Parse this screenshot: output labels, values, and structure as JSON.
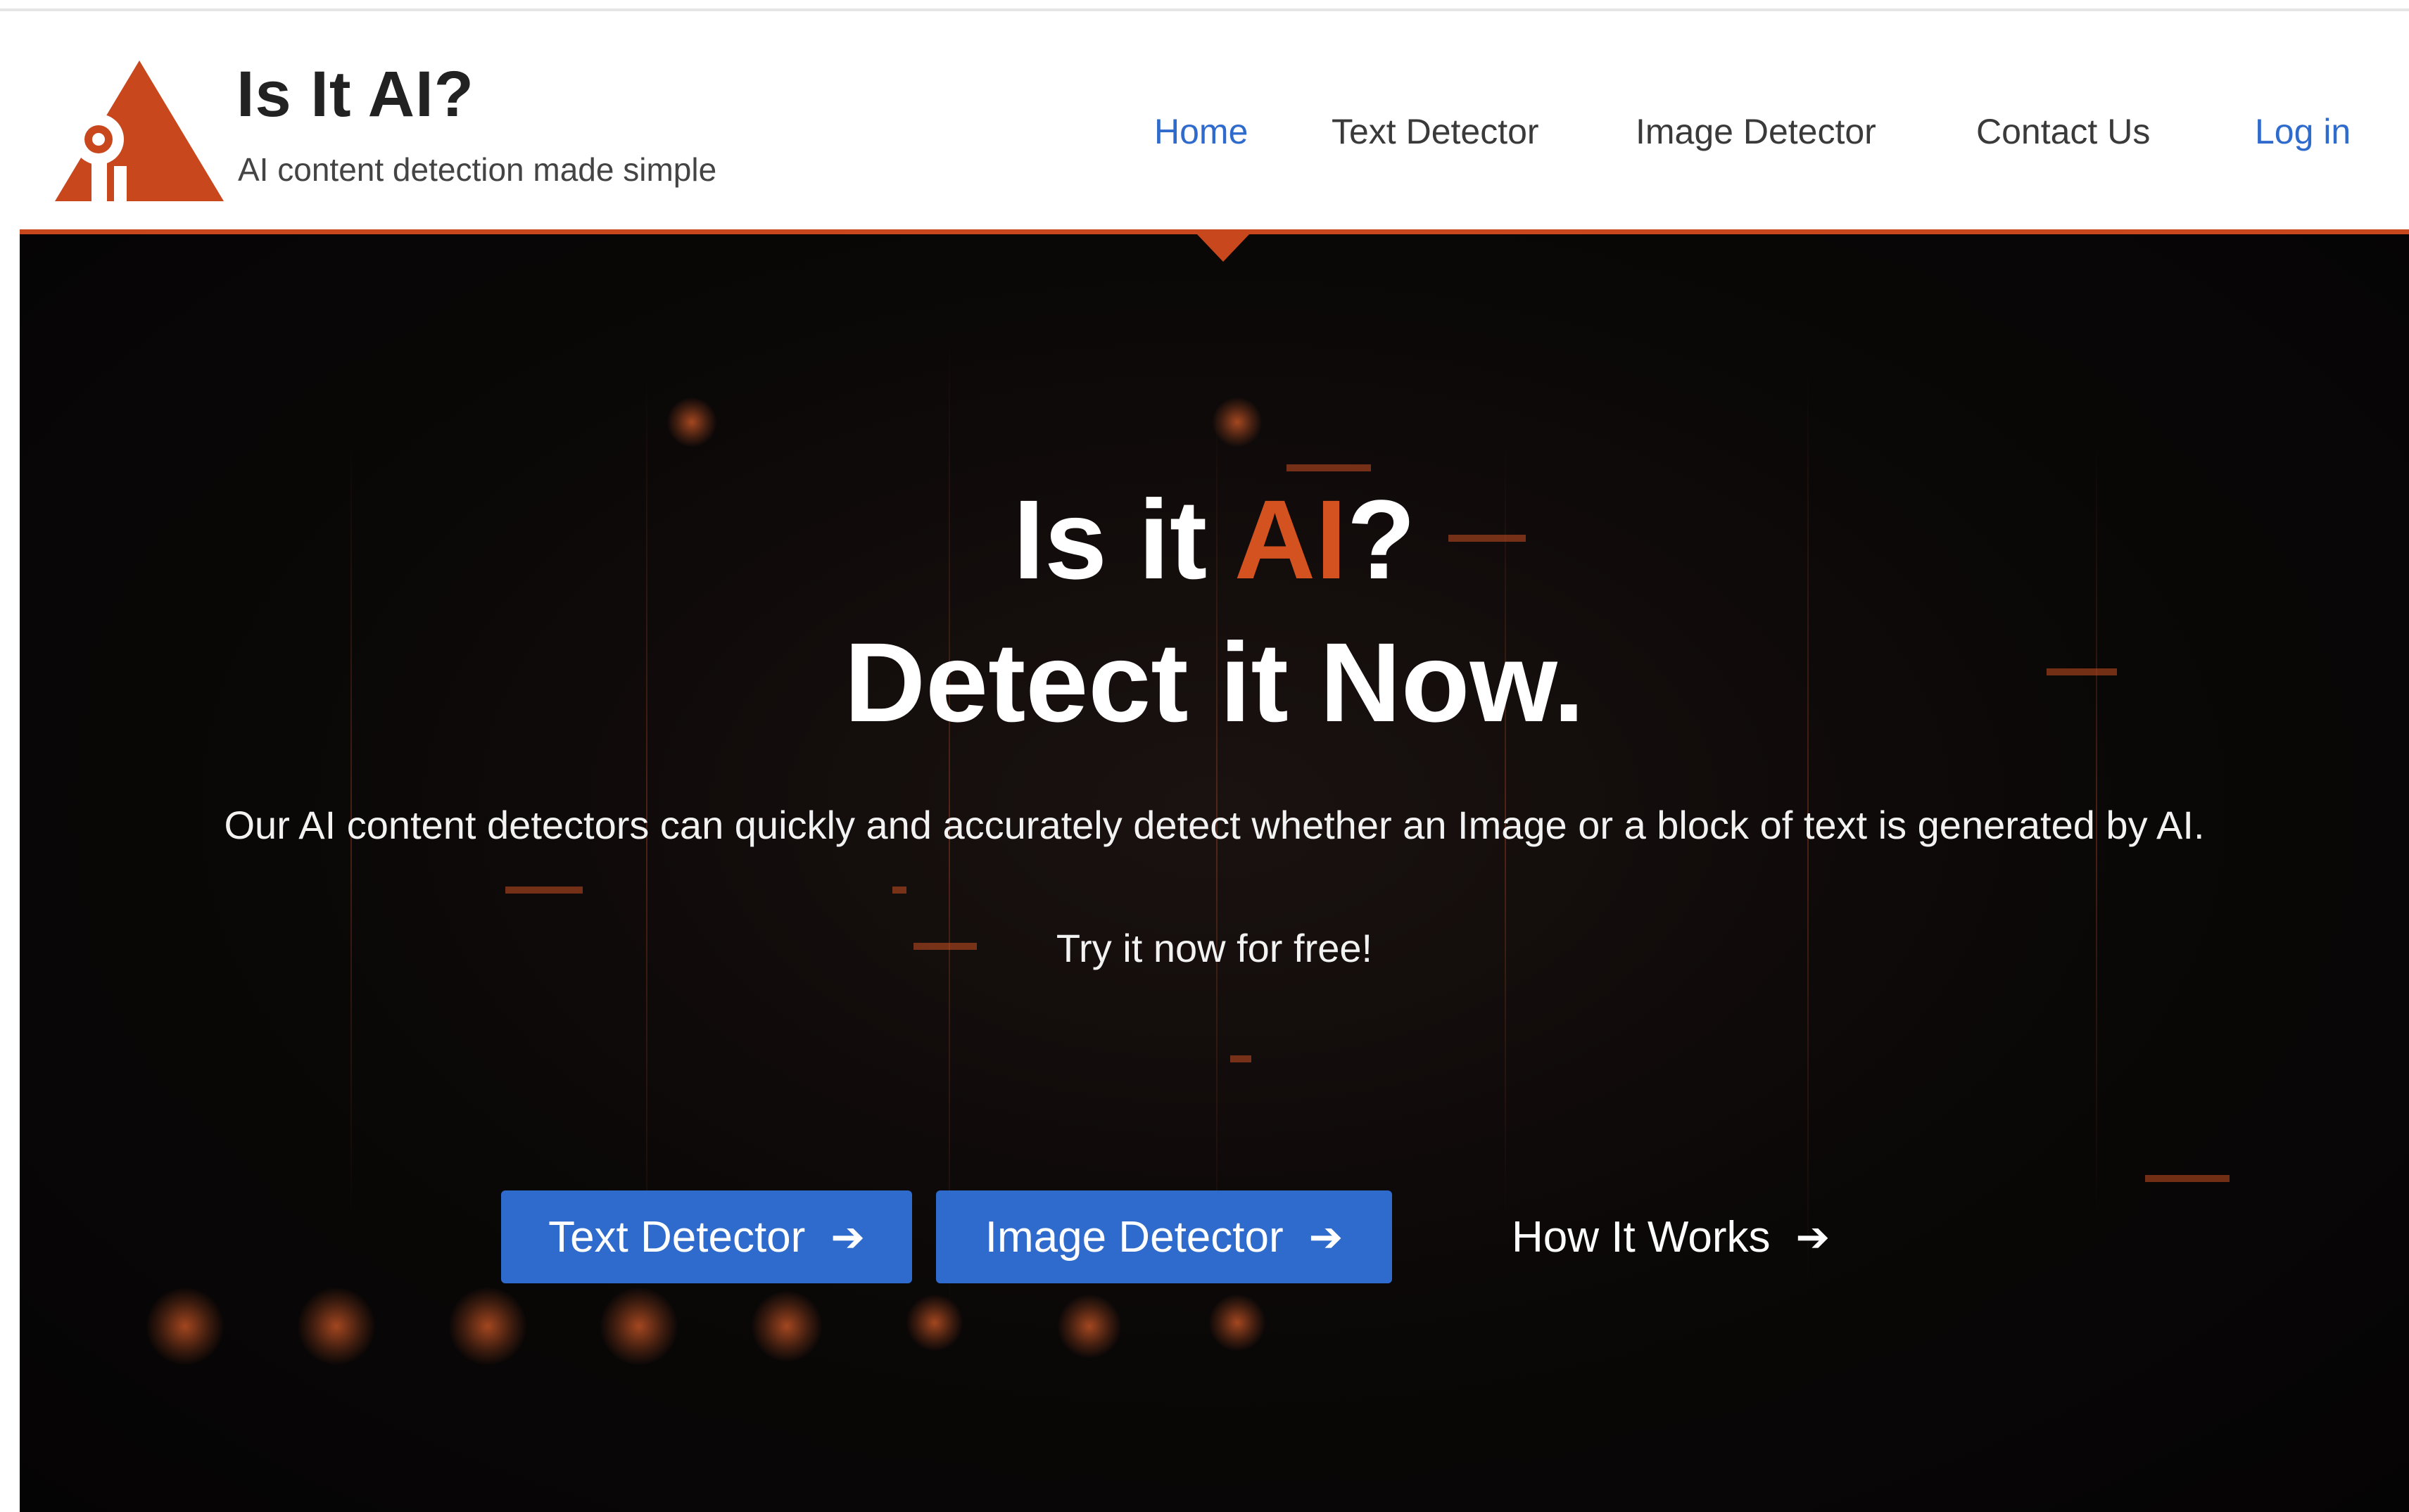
{
  "brand": {
    "title": "Is It AI?",
    "subtitle": "AI content detection made simple",
    "logo_icon": "triangle-eye-logo-icon",
    "accent_color": "#c8471c"
  },
  "nav": {
    "items": [
      {
        "label": "Home",
        "active": true
      },
      {
        "label": "Text Detector",
        "active": false
      },
      {
        "label": "Image Detector",
        "active": false
      },
      {
        "label": "Contact Us",
        "active": false
      },
      {
        "label": "Log in",
        "active": false
      }
    ],
    "link_color": "#2f6bcc"
  },
  "hero": {
    "title_prefix": "Is it ",
    "title_accent": "AI",
    "title_suffix": "?",
    "title_line2": "Detect it Now.",
    "description": "Our AI content detectors can quickly and accurately detect whether an Image or a block of text is generated by AI.",
    "cta_text": "Try it now for free!",
    "buttons": {
      "text_detector": "Text Detector",
      "image_detector": "Image Detector",
      "how_it_works": "How It Works",
      "arrow_icon": "arrow-right-icon"
    },
    "button_color": "#2f6bcc",
    "accent_color": "#d4521f"
  }
}
